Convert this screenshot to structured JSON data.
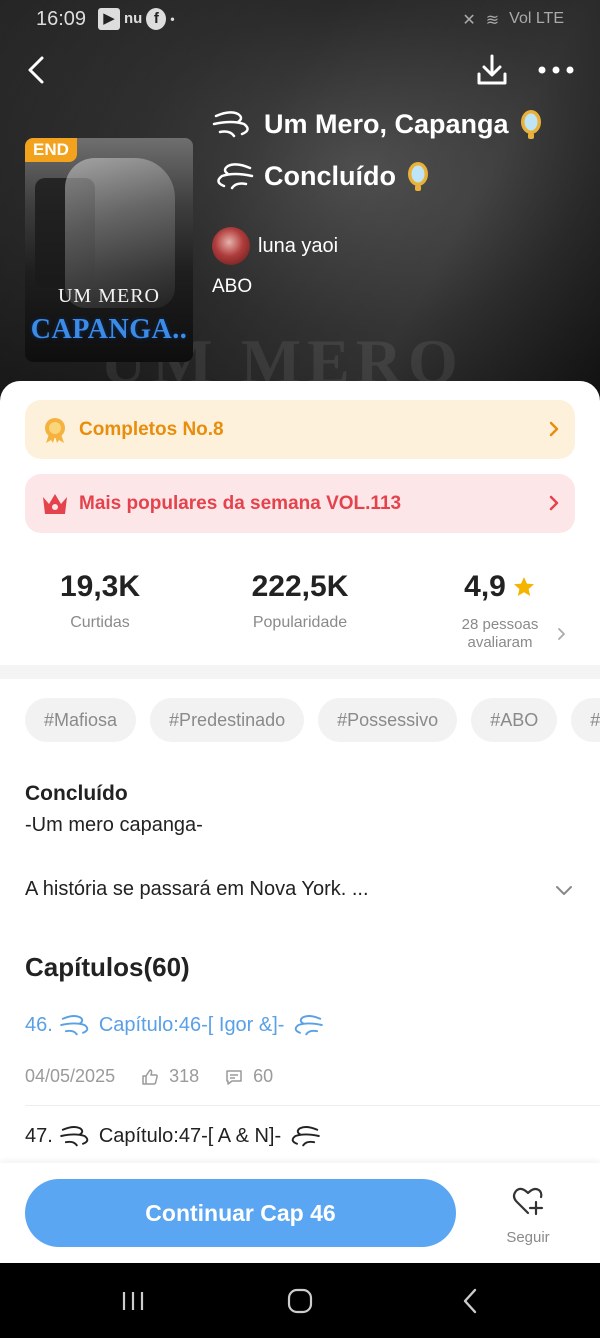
{
  "status_bar": {
    "time": "16:09",
    "app_icons": [
      "▶",
      "nu",
      "f",
      "•"
    ],
    "signal_text": "Vol LTE"
  },
  "header": {
    "title": "Um Mero, Capanga",
    "status": "Concluído",
    "author": "luna yaoi",
    "genre": "ABO"
  },
  "cover": {
    "badge": "END",
    "line1": "UM MERO",
    "line2": "CAPANGA.."
  },
  "banners": [
    {
      "label": "Completos No.8",
      "icon": "medal-icon",
      "color": "#e88d0c"
    },
    {
      "label": "Mais populares da semana VOL.113",
      "icon": "crown-icon",
      "color": "#e4434e"
    }
  ],
  "stats": {
    "likes": {
      "value": "19,3K",
      "label": "Curtidas"
    },
    "popularity": {
      "value": "222,5K",
      "label": "Popularidade"
    },
    "rating": {
      "value": "4,9",
      "label_line1": "28 pessoas",
      "label_line2": "avaliaram"
    }
  },
  "tags": [
    "#Mafiosa",
    "#Predestinado",
    "#Possessivo",
    "#ABO",
    "#"
  ],
  "description": {
    "title": "Concluído",
    "subtitle": "-Um mero capanga-",
    "body": "A história se passará em Nova York. ..."
  },
  "chapters": {
    "heading": "Capítulos(60)",
    "items": [
      {
        "number": "46.",
        "title": "Capítulo:46-[ Igor &]-",
        "date": "04/05/2025",
        "likes": "318",
        "comments": "60"
      },
      {
        "number": "47.",
        "title": "Capítulo:47-[ A & N]-"
      }
    ]
  },
  "actions": {
    "continue": "Continuar Cap 46",
    "follow": "Seguir"
  },
  "colors": {
    "accent": "#5aa6f2",
    "gold": "#e88d0c",
    "red": "#e4434e"
  }
}
